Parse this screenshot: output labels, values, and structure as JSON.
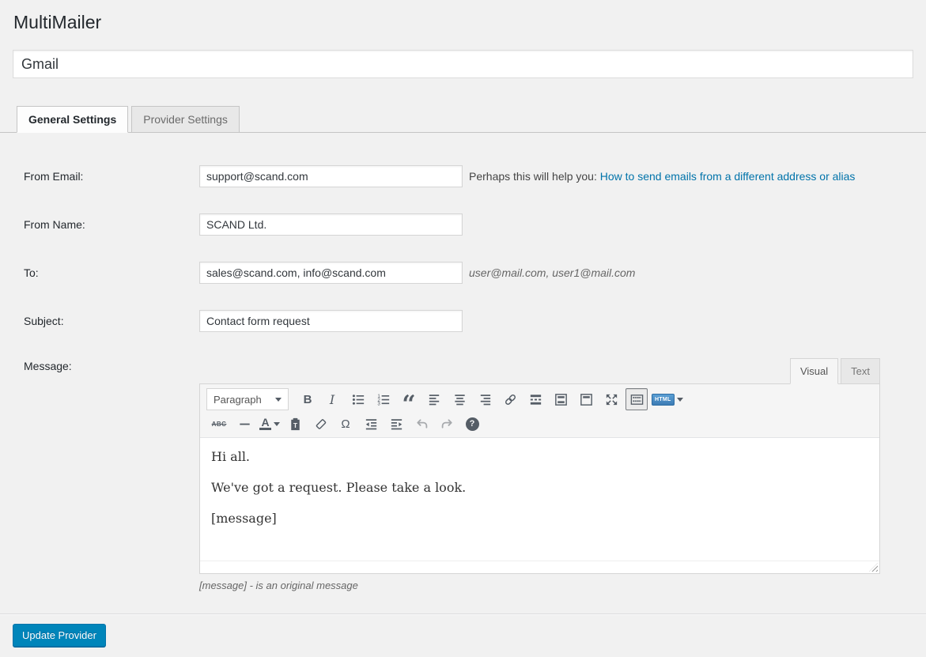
{
  "page": {
    "title": "MultiMailer"
  },
  "provider_name": {
    "value": "Gmail"
  },
  "tabs": [
    {
      "label": "General Settings",
      "active": true
    },
    {
      "label": "Provider Settings",
      "active": false
    }
  ],
  "form": {
    "from_email": {
      "label": "From Email:",
      "value": "support@scand.com",
      "help_prefix": "Perhaps this will help you:",
      "help_link_text": "How to send emails from a different address or alias"
    },
    "from_name": {
      "label": "From Name:",
      "value": "SCAND Ltd."
    },
    "to": {
      "label": "To:",
      "value": "sales@scand.com, info@scand.com",
      "hint": "user@mail.com, user1@mail.com"
    },
    "subject": {
      "label": "Subject:",
      "value": "Contact form request"
    },
    "message": {
      "label": "Message:",
      "hint": "[message] - is an original message"
    }
  },
  "editor": {
    "mode_tabs": [
      {
        "label": "Visual",
        "active": true
      },
      {
        "label": "Text",
        "active": false
      }
    ],
    "toolbar": {
      "paragraph_label": "Paragraph",
      "bold_glyph": "B",
      "italic_glyph": "I",
      "blockquote_glyph": "“",
      "strikethrough_glyph": "ABC",
      "text_color_glyph": "A",
      "special_char_glyph": "Ω",
      "paste_text_glyph": "T",
      "help_glyph": "?",
      "html_badge_label": "HTML",
      "numbered_list_glyphs": [
        "1",
        "2",
        "3"
      ]
    },
    "content_paragraphs": [
      "Hi all.",
      "We've got a request. Please take a look.",
      "[message]"
    ]
  },
  "footer": {
    "update_button_label": "Update Provider"
  },
  "colors": {
    "page_bg": "#f1f1f1",
    "link_blue": "#0073aa",
    "button_blue": "#0085ba",
    "icon_gray": "#555d66"
  }
}
